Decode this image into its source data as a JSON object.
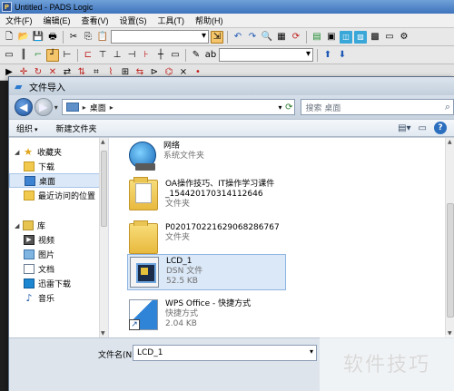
{
  "app": {
    "title": "Untitled - PADS Logic",
    "logo_letter": "P",
    "menu": [
      "文件(F)",
      "编辑(E)",
      "查看(V)",
      "设置(S)",
      "工具(T)",
      "帮助(H)"
    ]
  },
  "dialog": {
    "title": "文件导入",
    "address": {
      "location": "桌面",
      "separator": "▸"
    },
    "search_placeholder": "搜索 桌面",
    "commands": {
      "organize": "组织",
      "new_folder": "新建文件夹"
    },
    "help_glyph": "?",
    "nav": {
      "favorites": {
        "label": "收藏夹",
        "items": [
          {
            "label": "下载",
            "icon": "download-folder-icon"
          },
          {
            "label": "桌面",
            "icon": "desktop-icon",
            "selected": true
          },
          {
            "label": "最近访问的位置",
            "icon": "recent-places-icon"
          }
        ]
      },
      "libraries": {
        "label": "库",
        "items": [
          {
            "label": "视频",
            "icon": "videos-icon"
          },
          {
            "label": "图片",
            "icon": "pictures-icon"
          },
          {
            "label": "文档",
            "icon": "documents-icon"
          },
          {
            "label": "迅雷下载",
            "icon": "thunder-download-icon"
          },
          {
            "label": "音乐",
            "icon": "music-icon"
          }
        ]
      }
    },
    "files": [
      {
        "name": "网络",
        "type": "系统文件夹",
        "icon": "network-icon"
      },
      {
        "name": "OA操作技巧、IT操作学习课件",
        "name2": "_154420170314112646",
        "type": "文件夹",
        "icon": "folder-icon"
      },
      {
        "name": "P020170221629068286767",
        "type": "文件夹",
        "icon": "folder-icon"
      },
      {
        "name": "LCD_1",
        "type": "DSN 文件",
        "size": "52.5 KB",
        "icon": "dsn-file-icon",
        "selected": true
      },
      {
        "name": "WPS Office - 快捷方式",
        "type": "快捷方式",
        "size": "2.04 KB",
        "icon": "wps-shortcut-icon"
      }
    ],
    "filename_label": "文件名(N):",
    "filename_value": "LCD_1"
  },
  "watermark": "软件技巧"
}
